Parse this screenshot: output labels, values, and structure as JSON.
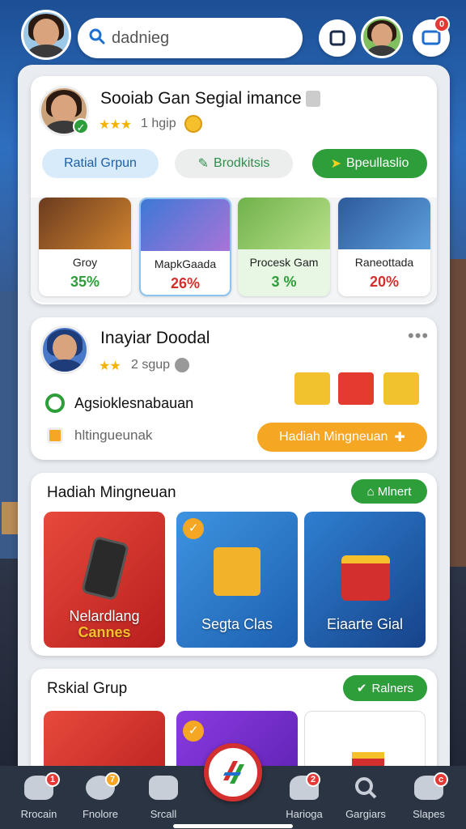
{
  "header": {
    "search_value": "dadnieg",
    "notif_badge": "0"
  },
  "card1": {
    "title": "Sooiab Gan Segial imance",
    "subtitle": "1 hgip",
    "btn1": "Ratial Grpun",
    "btn2": "Brodkitsis",
    "btn3": "Bpeullaslio",
    "players": [
      {
        "name": "Groy",
        "pct": "35%",
        "pct_color": "#2e9e3a"
      },
      {
        "name": "MapkGaada",
        "pct": "26%",
        "pct_color": "#d32f2f"
      },
      {
        "name": "Procesk Gam",
        "pct": "3 %",
        "pct_color": "#2e9e3a"
      },
      {
        "name": "Raneottada",
        "pct": "20%",
        "pct_color": "#d32f2f"
      }
    ]
  },
  "card2": {
    "title": "Inayiar Doodal",
    "subtitle": "2 sgup",
    "line1": "Agsioklesnabauan",
    "line2": "hltingueunak",
    "cta": "Hadiah Mingneuan"
  },
  "card3": {
    "title": "Hadiah Mingneuan",
    "pill": "Mlnert",
    "tiles": [
      {
        "l1": "Nelardlang",
        "l2": "Cannes"
      },
      {
        "l1": "Segta Clas"
      },
      {
        "l1": "Eiaarte Gial"
      }
    ]
  },
  "card4": {
    "title": "Rskial Grup",
    "pill": "Ralners"
  },
  "nav": {
    "items": [
      {
        "label": "Rrocain",
        "badge": "1"
      },
      {
        "label": "Fnolore",
        "badge": "7"
      },
      {
        "label": "Srcall"
      },
      {
        "label": "Harioga",
        "badge": "2"
      },
      {
        "label": "Gargiars"
      },
      {
        "label": "Slapes",
        "badge": "c"
      }
    ]
  },
  "colors": {
    "green": "#2e9e3a",
    "orange": "#f5a623",
    "blue": "#2f80d1",
    "red": "#d32f2f"
  }
}
